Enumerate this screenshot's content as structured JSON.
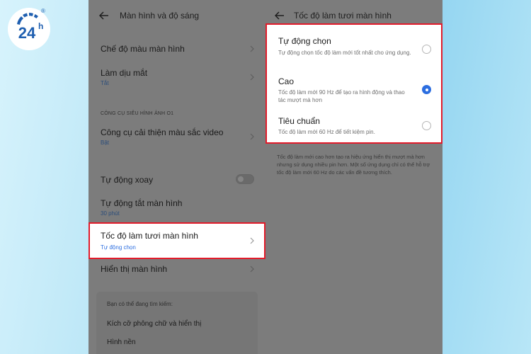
{
  "logo": {
    "text": "24",
    "superscript": "h",
    "registered": "®"
  },
  "left_screen": {
    "title": "Màn hình và độ sáng",
    "items": [
      {
        "label": "Chế độ màu màn hình"
      },
      {
        "label": "Làm dịu mắt",
        "sub": "Tắt"
      },
      {
        "section": "CÔNG CỤ SIÊU HÌNH ẢNH O1"
      },
      {
        "label": "Công cụ cải thiện màu sắc video",
        "sub": "Bật"
      },
      {
        "label": "Tự động xoay",
        "toggle": false
      },
      {
        "label": "Tự động tắt màn hình",
        "sub": "30 phút"
      },
      {
        "label": "Tốc độ làm tươi màn hình",
        "sub": "Tự động chọn"
      },
      {
        "label": "Hiển thị màn hình"
      }
    ],
    "search_suggestions": {
      "heading": "Bạn có thể đang tìm kiếm:",
      "items": [
        "Kích cỡ phông chữ và hiển thị",
        "Hình nền"
      ]
    }
  },
  "right_screen": {
    "title": "Tốc độ làm tươi màn hình",
    "options": [
      {
        "title": "Tự động chọn",
        "desc": "Tự động chọn tốc độ làm mới tốt nhất cho ứng dụng.",
        "selected": false
      },
      {
        "title": "Cao",
        "desc": "Tốc độ làm mới 90 Hz để tạo ra hình động và thao tác mượt mà hơn",
        "selected": true
      },
      {
        "title": "Tiêu chuẩn",
        "desc": "Tốc độ làm mới 60 Hz để tiết kiệm pin.",
        "selected": false
      }
    ],
    "footnote": "Tốc độ làm mới cao hơn tạo ra hiệu ứng hiển thị mượt mà hơn nhưng sử dụng nhiều pin hơn. Một số ứng dụng chỉ có thể hỗ trợ tốc độ làm mới 60 Hz do các vấn đề tương thích."
  },
  "colors": {
    "highlight_border": "#e21b2a",
    "radio_selected": "#2c6ee0",
    "sub_text": "#2b4d7a"
  }
}
